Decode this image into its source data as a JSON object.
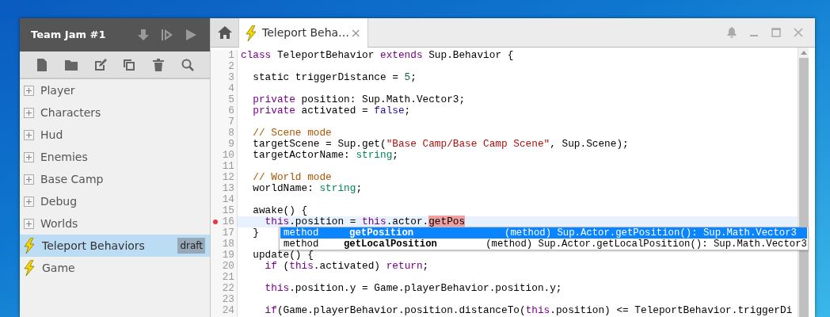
{
  "project": {
    "title": "Team Jam #1"
  },
  "tree": [
    {
      "label": "Player",
      "kind": "folder",
      "selected": false
    },
    {
      "label": "Characters",
      "kind": "folder",
      "selected": false
    },
    {
      "label": "Hud",
      "kind": "folder",
      "selected": false
    },
    {
      "label": "Enemies",
      "kind": "folder",
      "selected": false
    },
    {
      "label": "Base Camp",
      "kind": "folder",
      "selected": false
    },
    {
      "label": "Debug",
      "kind": "folder",
      "selected": false
    },
    {
      "label": "Worlds",
      "kind": "folder",
      "selected": false
    },
    {
      "label": "Teleport Behaviors",
      "kind": "script",
      "selected": true,
      "badge": "draft"
    },
    {
      "label": "Game",
      "kind": "script",
      "selected": false
    }
  ],
  "tabs": [
    {
      "label": "Teleport Beha…",
      "close": "×",
      "selected": true
    }
  ],
  "lines": [
    {
      "number": "1",
      "tokens": [
        {
          "text": "class",
          "kind": "keyword"
        },
        {
          "text": " TeleportBehavior ",
          "kind": "plain"
        },
        {
          "text": "extends",
          "kind": "keyword"
        },
        {
          "text": " Sup.Behavior {",
          "kind": "plain"
        }
      ]
    },
    {
      "number": "2"
    },
    {
      "number": "3",
      "tokens": [
        {
          "text": "  static triggerDistance = ",
          "kind": "plain"
        },
        {
          "text": "5",
          "kind": "number"
        },
        {
          "text": ";",
          "kind": "plain"
        }
      ]
    },
    {
      "number": "4"
    },
    {
      "number": "5",
      "tokens": [
        {
          "text": "  private",
          "kind": "keyword"
        },
        {
          "text": " position: Sup.Math.Vector3;",
          "kind": "plain"
        }
      ]
    },
    {
      "number": "6",
      "tokens": [
        {
          "text": "  private",
          "kind": "keyword"
        },
        {
          "text": " activated = ",
          "kind": "plain"
        },
        {
          "text": "false",
          "kind": "atom"
        },
        {
          "text": ";",
          "kind": "plain"
        }
      ]
    },
    {
      "number": "7"
    },
    {
      "number": "8",
      "tokens": [
        {
          "text": "  // Scene mode",
          "kind": "comment"
        }
      ]
    },
    {
      "number": "9",
      "tokens": [
        {
          "text": "  targetScene = Sup.get(",
          "kind": "plain"
        },
        {
          "text": "\"Base Camp/Base Camp Scene\"",
          "kind": "string"
        },
        {
          "text": ", Sup.Scene);",
          "kind": "plain"
        }
      ]
    },
    {
      "number": "10",
      "tokens": [
        {
          "text": "  targetActorName: ",
          "kind": "plain"
        },
        {
          "text": "string",
          "kind": "type"
        },
        {
          "text": ";",
          "kind": "plain"
        }
      ]
    },
    {
      "number": "11"
    },
    {
      "number": "12",
      "tokens": [
        {
          "text": "  // World mode",
          "kind": "comment"
        }
      ]
    },
    {
      "number": "13",
      "tokens": [
        {
          "text": "  worldName: ",
          "kind": "plain"
        },
        {
          "text": "string",
          "kind": "type"
        },
        {
          "text": ";",
          "kind": "plain"
        }
      ]
    },
    {
      "number": "14"
    },
    {
      "number": "15",
      "tokens": [
        {
          "text": "  awake() {",
          "kind": "plain"
        }
      ]
    },
    {
      "number": "16",
      "breakpoint": true,
      "active": true,
      "tokens": [
        {
          "text": "    this",
          "kind": "keyword"
        },
        {
          "text": ".position = ",
          "kind": "plain"
        },
        {
          "text": "this",
          "kind": "keyword"
        },
        {
          "text": ".actor.",
          "kind": "plain"
        },
        {
          "text": "getPos",
          "kind": "match"
        }
      ]
    },
    {
      "number": "17",
      "tokens": [
        {
          "text": "  }",
          "kind": "plain"
        }
      ]
    },
    {
      "number": "18"
    },
    {
      "number": "19",
      "tokens": [
        {
          "text": "  update() {",
          "kind": "plain"
        }
      ]
    },
    {
      "number": "20",
      "tokens": [
        {
          "text": "    if",
          "kind": "keyword"
        },
        {
          "text": " (",
          "kind": "plain"
        },
        {
          "text": "this",
          "kind": "keyword"
        },
        {
          "text": ".activated) ",
          "kind": "plain"
        },
        {
          "text": "return",
          "kind": "keyword"
        },
        {
          "text": ";",
          "kind": "plain"
        }
      ]
    },
    {
      "number": "21"
    },
    {
      "number": "22",
      "tokens": [
        {
          "text": "    this",
          "kind": "keyword"
        },
        {
          "text": ".position.y = Game.playerBehavior.position.y;",
          "kind": "plain"
        }
      ]
    },
    {
      "number": "23"
    },
    {
      "number": "24",
      "tokens": [
        {
          "text": "    if",
          "kind": "keyword"
        },
        {
          "text": "(Game.playerBehavior.position.distanceTo(",
          "kind": "plain"
        },
        {
          "text": "this",
          "kind": "keyword"
        },
        {
          "text": ".position) <= TeleportBehavior.triggerDi",
          "kind": "plain"
        }
      ]
    }
  ],
  "autocomplete": [
    {
      "kind": "method",
      "name": "getPosition",
      "detail": "(method) Sup.Actor.getPosition(): Sup.Math.Vector3",
      "selected": true
    },
    {
      "kind": "method",
      "name": "getLocalPosition",
      "detail": "(method) Sup.Actor.getLocalPosition(): Sup.Math.Vector3",
      "selected": false
    }
  ]
}
